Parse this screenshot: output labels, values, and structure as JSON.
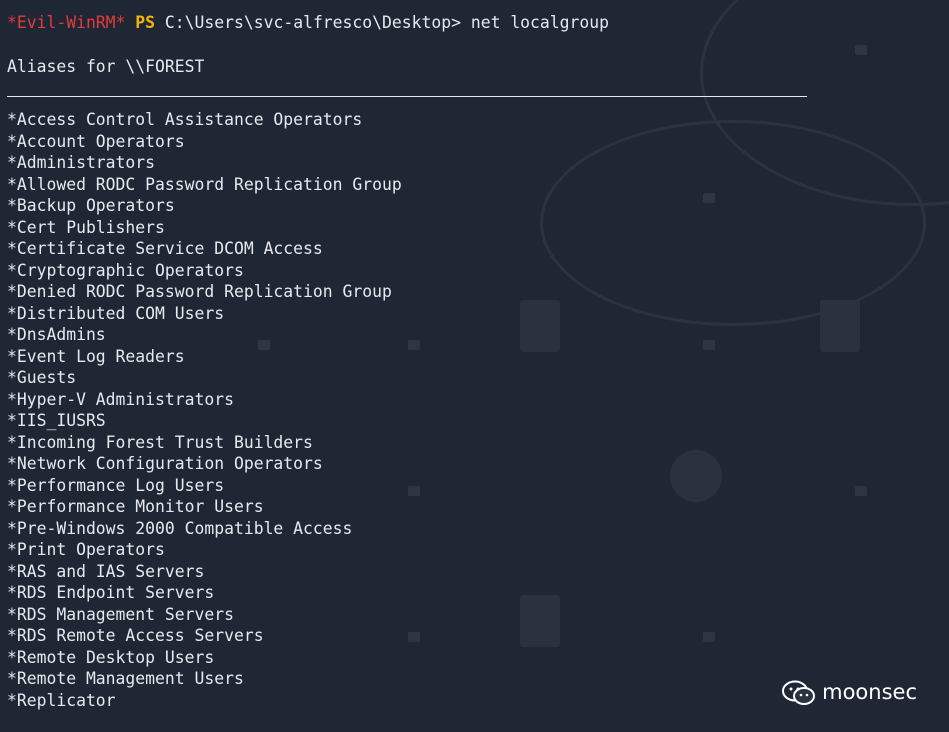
{
  "terminal": {
    "prompt_tag": "*Evil-WinRM*",
    "prompt_shell": "PS",
    "prompt_path": "C:\\Users\\svc-alfresco\\Desktop>",
    "command": "net localgroup",
    "aliases_header": "Aliases for \\\\FOREST",
    "groups": [
      "*Access Control Assistance Operators",
      "*Account Operators",
      "*Administrators",
      "*Allowed RODC Password Replication Group",
      "*Backup Operators",
      "*Cert Publishers",
      "*Certificate Service DCOM Access",
      "*Cryptographic Operators",
      "*Denied RODC Password Replication Group",
      "*Distributed COM Users",
      "*DnsAdmins",
      "*Event Log Readers",
      "*Guests",
      "*Hyper-V Administrators",
      "*IIS_IUSRS",
      "*Incoming Forest Trust Builders",
      "*Network Configuration Operators",
      "*Performance Log Users",
      "*Performance Monitor Users",
      "*Pre-Windows 2000 Compatible Access",
      "*Print Operators",
      "*RAS and IAS Servers",
      "*RDS Endpoint Servers",
      "*RDS Management Servers",
      "*RDS Remote Access Servers",
      "*Remote Desktop Users",
      "*Remote Management Users",
      "*Replicator"
    ]
  },
  "watermark": {
    "text": "moonsec",
    "icon": "wechat-icon"
  },
  "colors": {
    "background": "#202734",
    "text": "#e6e9ee",
    "prompt_tag": "#e23b3b",
    "prompt_shell": "#f5b800"
  }
}
